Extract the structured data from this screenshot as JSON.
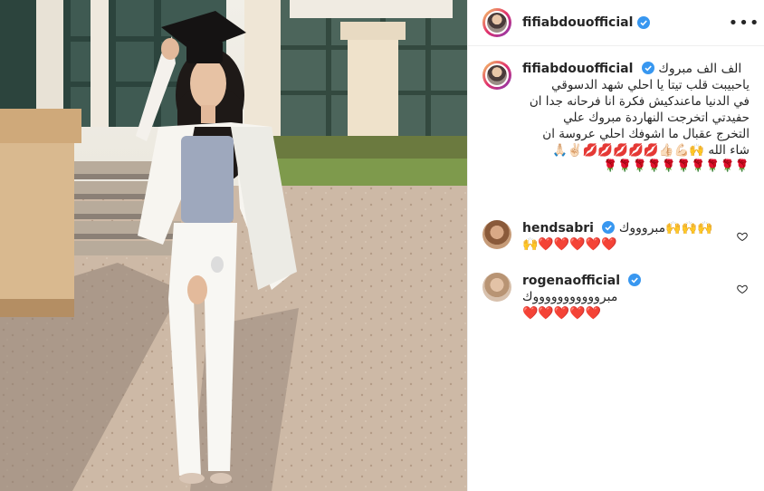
{
  "post": {
    "username": "fifiabdouofficial",
    "verified": true,
    "more_icon": "ellipsis"
  },
  "caption": {
    "username": "fifiabdouofficial",
    "text_first": "الف الف مبروك",
    "text_rest": "ياحبيبت قلب تيتا يا احلي شهد الدسوقي\nفي الدنيا ماعندكيش فكرة انا فرحانه جدا ان\nحفيدتي اتخرجت النهاردة مبروك علي\nالتخرج عقبال ما اشوفك احلي عروسة ان\nشاء الله 🙌💪🏻👍🏻💋💋💋💋💋✌🏻🙏🏻",
    "emoji_line": "🌹🌹🌹🌹🌹🌹🌹🌹🌹🌹"
  },
  "comments": [
    {
      "username": "hendsabri",
      "verified": true,
      "text": "مبروووك🙌🙌🙌",
      "text2": "🙌❤️❤️❤️❤️❤️"
    },
    {
      "username": "rogenaofficial",
      "verified": true,
      "text": "مبروووووووووووك",
      "text2": "❤️❤️❤️❤️❤️"
    }
  ],
  "colors": {
    "verified_blue": "#3897f0",
    "text": "#262626",
    "heart_red": "#ed4956"
  }
}
